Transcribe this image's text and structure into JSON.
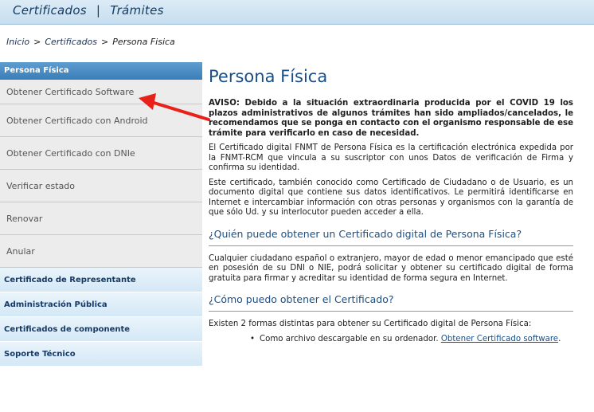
{
  "header": {
    "nav": [
      "Certificados",
      "Trámites"
    ],
    "separator": "|"
  },
  "breadcrumb": {
    "items": [
      "Inicio",
      "Certificados",
      "Persona Fisica"
    ],
    "separator": ">"
  },
  "sidebar": {
    "heading": "Persona Física",
    "items": [
      {
        "label": "Obtener Certificado Software"
      },
      {
        "label": "Obtener Certificado con Android"
      },
      {
        "label": "Obtener Certificado con DNIe"
      },
      {
        "label": "Verificar estado"
      },
      {
        "label": "Renovar"
      },
      {
        "label": "Anular"
      }
    ],
    "sections": [
      {
        "label": "Certificado de Representante"
      },
      {
        "label": "Administración Pública"
      },
      {
        "label": "Certificados de componente"
      },
      {
        "label": "Soporte Técnico"
      }
    ]
  },
  "main": {
    "title": "Persona Física",
    "notice": "AVISO: Debido a la situación extraordinaria producida por el COVID 19 los plazos administrativos de algunos trámites han sido ampliados/cancelados, le recomendamos que se ponga en contacto con el organismo responsable de ese trámite para verificarlo en caso de necesidad.",
    "paragraphs": [
      "El Certificado digital FNMT de Persona Física es la certificación electrónica expedida por la FNMT-RCM que vincula a su suscriptor con unos Datos de verificación de Firma y confirma su identidad.",
      "Este certificado, también conocido como Certificado de Ciudadano o de Usuario, es un documento digital que contiene sus datos identificativos. Le permitirá identificarse en Internet e intercambiar información con otras personas y organismos con la garantía de que sólo Ud. y su interlocutor pueden acceder a ella."
    ],
    "section1": {
      "heading": "¿Quién puede obtener un Certificado digital de Persona Física?",
      "text": "Cualquier ciudadano español o extranjero, mayor de edad o menor emancipado que esté en posesión de su DNI o NIE, podrá solicitar y obtener su certificado digital de forma gratuita para firmar y acreditar su identidad de forma segura en Internet."
    },
    "section2": {
      "heading": "¿Cómo puedo obtener el Certificado?",
      "text": "Existen 2 formas distintas para obtener su Certificado digital de Persona Física:",
      "bullets": [
        {
          "bullet": "•",
          "text": "Como archivo descargable en su ordenador. ",
          "link": "Obtener Certificado software",
          "after": "."
        }
      ]
    }
  },
  "annotation": {
    "arrow_color": "#e8211b"
  }
}
